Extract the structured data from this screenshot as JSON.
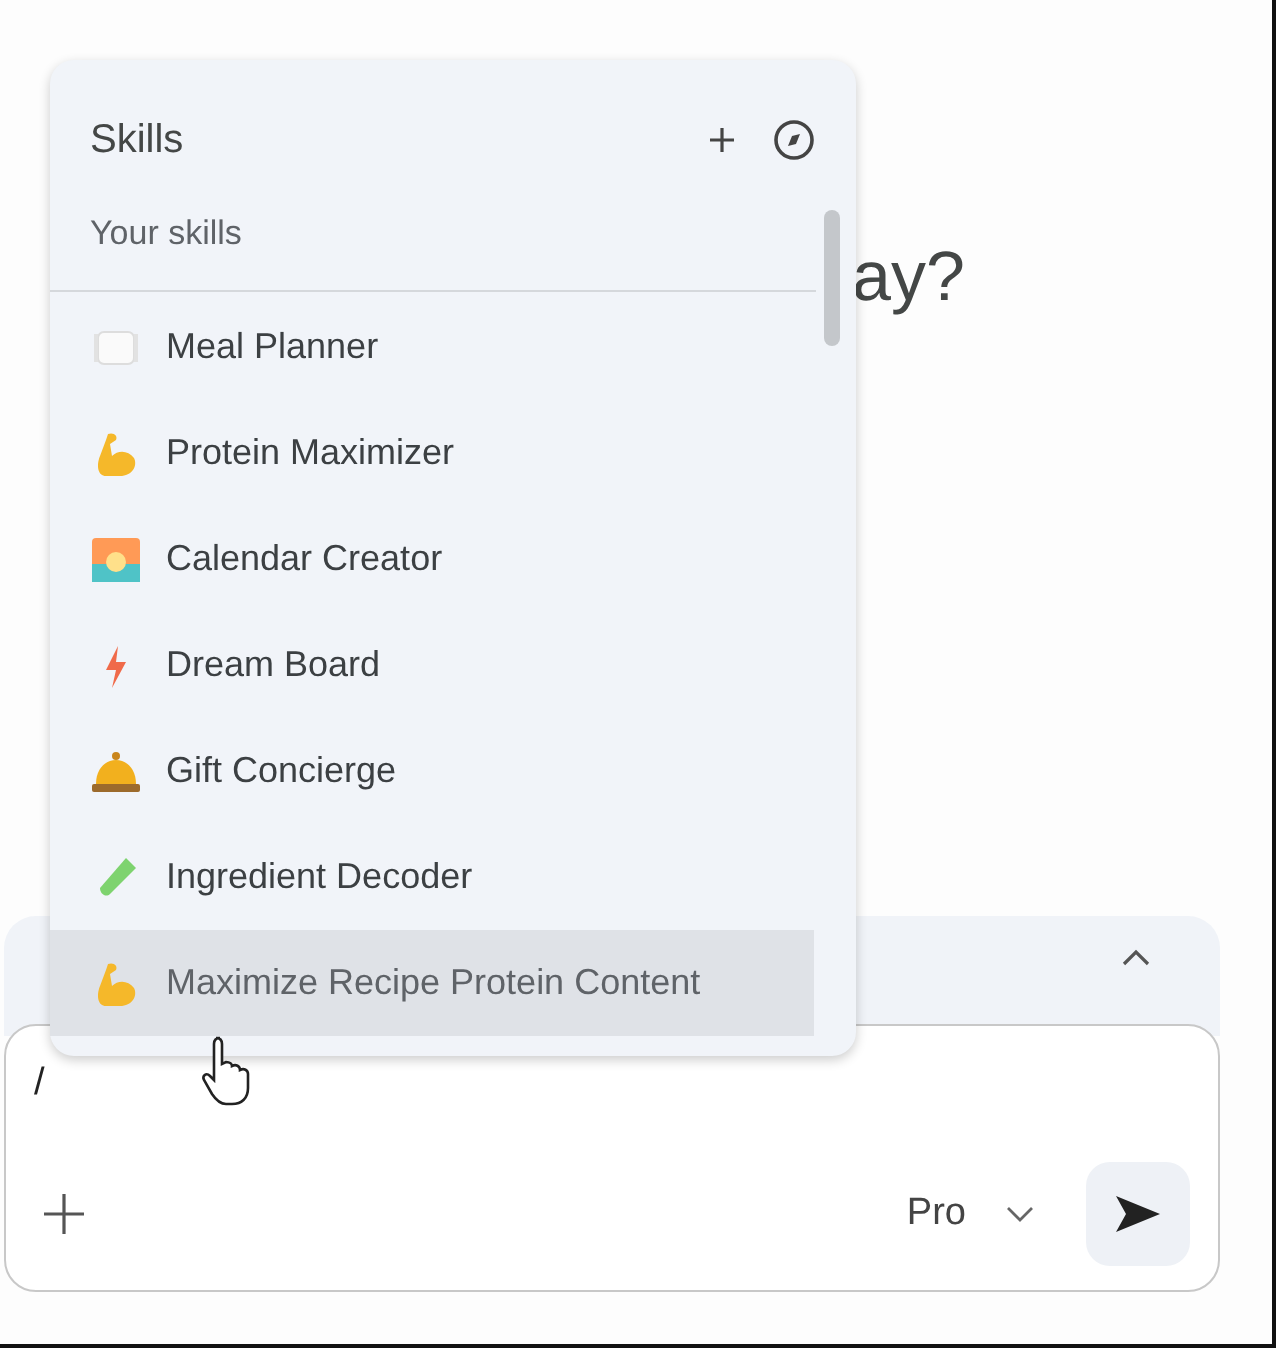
{
  "heading": "ay?",
  "skills_menu": {
    "title": "Skills",
    "section": "Your skills",
    "items": [
      {
        "label": "Meal Planner",
        "kind": "plate",
        "selected": false
      },
      {
        "label": "Protein Maximizer",
        "kind": "muscle",
        "selected": false
      },
      {
        "label": "Calendar Creator",
        "kind": "sunrise",
        "selected": false
      },
      {
        "label": "Dream Board",
        "kind": "bolt",
        "selected": false
      },
      {
        "label": "Gift Concierge",
        "kind": "bell",
        "selected": false
      },
      {
        "label": "Ingredient Decoder",
        "kind": "tube",
        "selected": false
      },
      {
        "label": "Maximize Recipe Protein Content",
        "kind": "muscle",
        "selected": true
      }
    ]
  },
  "composer": {
    "value": "/",
    "model": "Pro"
  }
}
